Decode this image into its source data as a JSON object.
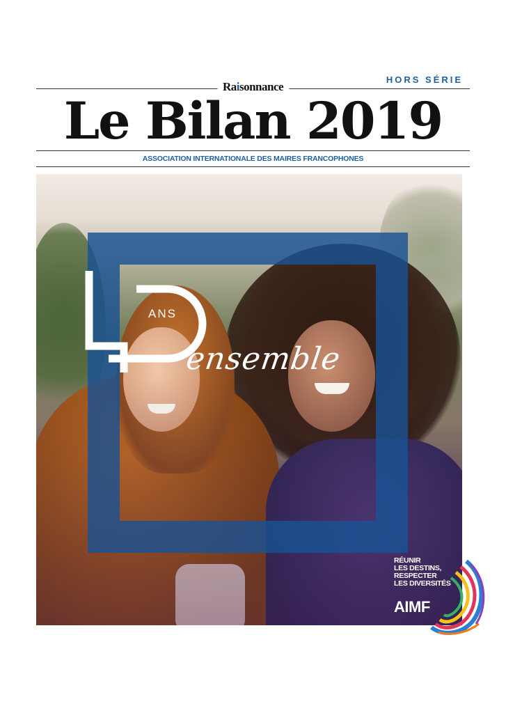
{
  "masthead": {
    "edition": "HORS SÉRIE",
    "brand_prefix": "Ra",
    "brand_accent": "i",
    "brand_suffix": "sonnance",
    "title": "Le Bilan 2019",
    "subtitle": "ASSOCIATION INTERNATIONALE DES MAIRES FRANCOPHONES"
  },
  "cover": {
    "number": "40",
    "ans": "ANS",
    "ensemble": "ensemble"
  },
  "logo": {
    "line1": "RÉUNIR",
    "line2": "LES DESTINS,",
    "line3": "RESPECTER",
    "line4": "LES DIVERSITÉS",
    "name": "AIMF"
  },
  "colors": {
    "accent_blue": "#1f5fa0",
    "frame_blue": "#1a5294",
    "text_dark": "#111111"
  }
}
